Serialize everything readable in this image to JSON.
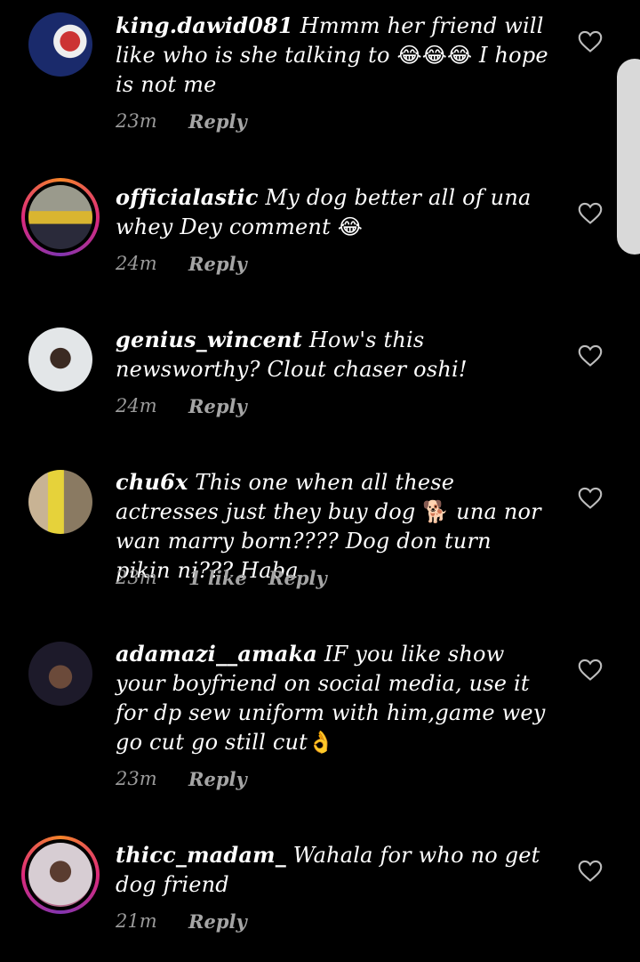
{
  "comments": [
    {
      "username": "king.dawid081",
      "text": " Hmmm her friend  will like who is she talking  to ",
      "emoji": "😂😂😂",
      "text2": " I hope is not me",
      "time": "23m",
      "likes": "",
      "reply": "Reply",
      "avatar_ring": false,
      "avatar_color": "#1a2a6b"
    },
    {
      "username": "officialastic",
      "text": " My dog better all of una whey Dey comment ",
      "emoji": "😂",
      "text2": "",
      "time": "24m",
      "likes": "",
      "reply": "Reply",
      "avatar_ring": true,
      "avatar_color": "#7a7a6a"
    },
    {
      "username": "genius_wincent",
      "text": " How's this newsworthy? Clout chaser oshi!",
      "emoji": "",
      "text2": "",
      "time": "24m",
      "likes": "",
      "reply": "Reply",
      "avatar_ring": false,
      "avatar_color": "#d8dde0"
    },
    {
      "username": "chu6x",
      "text": " This one when all these actresses just they buy dog ",
      "emoji": "🐕",
      "text2": " una nor wan marry born???? Dog don turn pikin ni??? Haba",
      "time": "23m",
      "likes": "1 like",
      "reply": "Reply",
      "avatar_ring": false,
      "avatar_color": "#b9a58a"
    },
    {
      "username": "adamazi__amaka",
      "text": " IF you like show your boyfriend on social media, use it for dp sew uniform with him,game wey go cut go still cut",
      "emoji": "👌",
      "text2": "",
      "time": "23m",
      "likes": "",
      "reply": "Reply",
      "avatar_ring": false,
      "avatar_color": "#1d1a2a"
    },
    {
      "username": "thicc_madam_",
      "text": " Wahala for who no get dog friend",
      "emoji": "",
      "text2": "",
      "time": "21m",
      "likes": "",
      "reply": "Reply",
      "avatar_ring": true,
      "avatar_color": "#c9b9c4"
    }
  ]
}
